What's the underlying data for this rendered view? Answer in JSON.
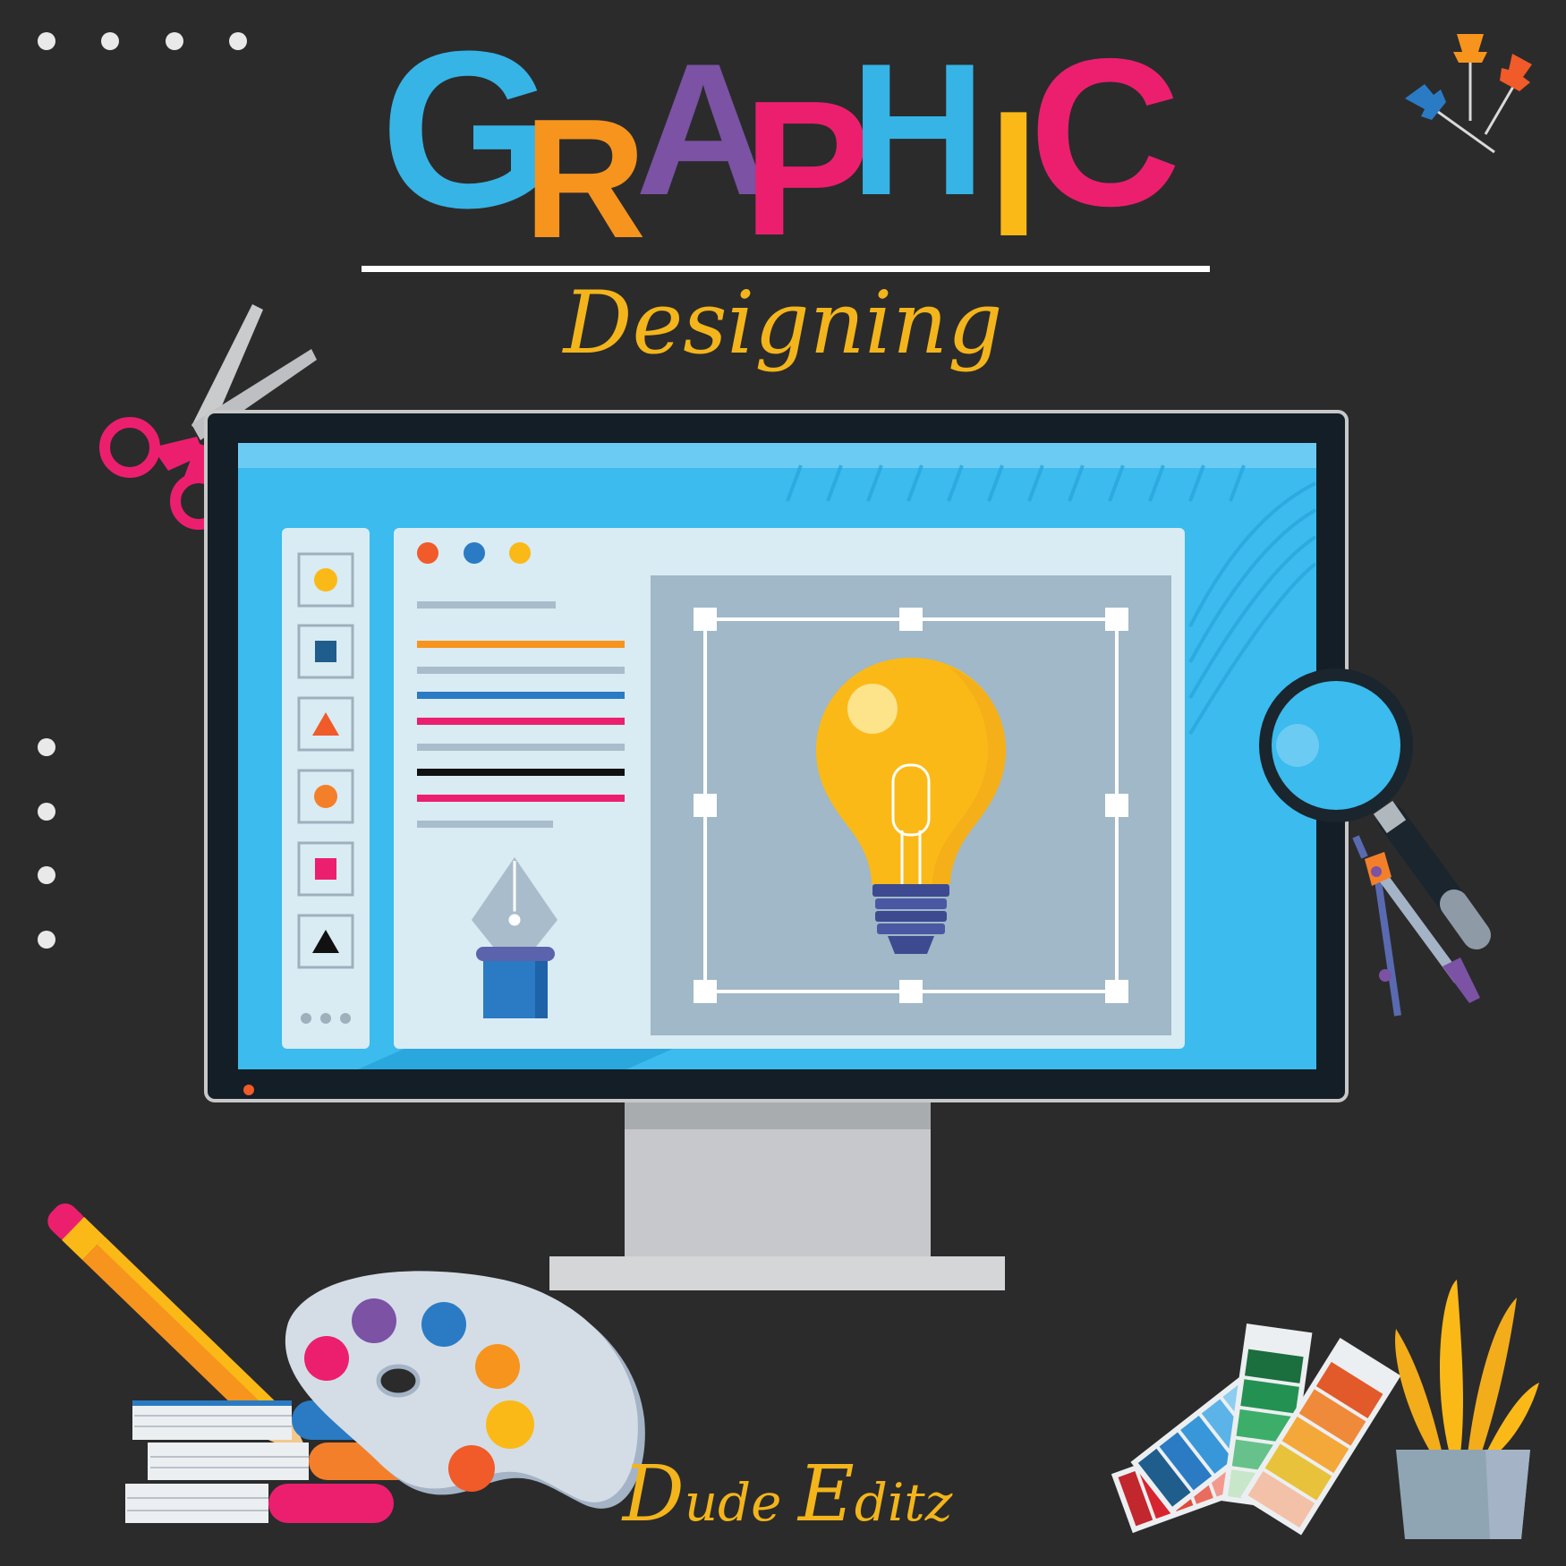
{
  "title": {
    "letters": [
      {
        "char": "G",
        "color": "#36b4e6"
      },
      {
        "char": "R",
        "color": "#f7941d"
      },
      {
        "char": "A",
        "color": "#7b52a4"
      },
      {
        "char": "P",
        "color": "#ec1f6e"
      },
      {
        "char": "H",
        "color": "#36b4e6"
      },
      {
        "char": "I",
        "color": "#fbb917"
      },
      {
        "char": "C",
        "color": "#ec1f6e"
      }
    ]
  },
  "subtitle": "Designing",
  "brand": {
    "first_initial": "D",
    "first_rest": "ude",
    "second_initial": "E",
    "second_rest": "ditz"
  },
  "colors": {
    "background": "#2b2b2c",
    "screen": "#3bbbee",
    "accent_yellow": "#f3b51b",
    "accent_pink": "#ec1f6e",
    "accent_orange": "#f7941d",
    "accent_blue": "#2a7bc4"
  },
  "toolbar": {
    "tools": [
      "circle-tool-icon",
      "square-tool-icon",
      "triangle-tool-icon",
      "circle-tool-icon",
      "square-tool-icon",
      "triangle-tool-icon"
    ]
  },
  "icons": [
    "scissors-icon",
    "push-pins-icon",
    "magnifier-icon",
    "compass-icon",
    "pencil-icon",
    "palette-icon",
    "books-icon",
    "color-swatch-icon",
    "plant-pot-icon",
    "pen-nib-icon",
    "light-bulb-icon"
  ]
}
